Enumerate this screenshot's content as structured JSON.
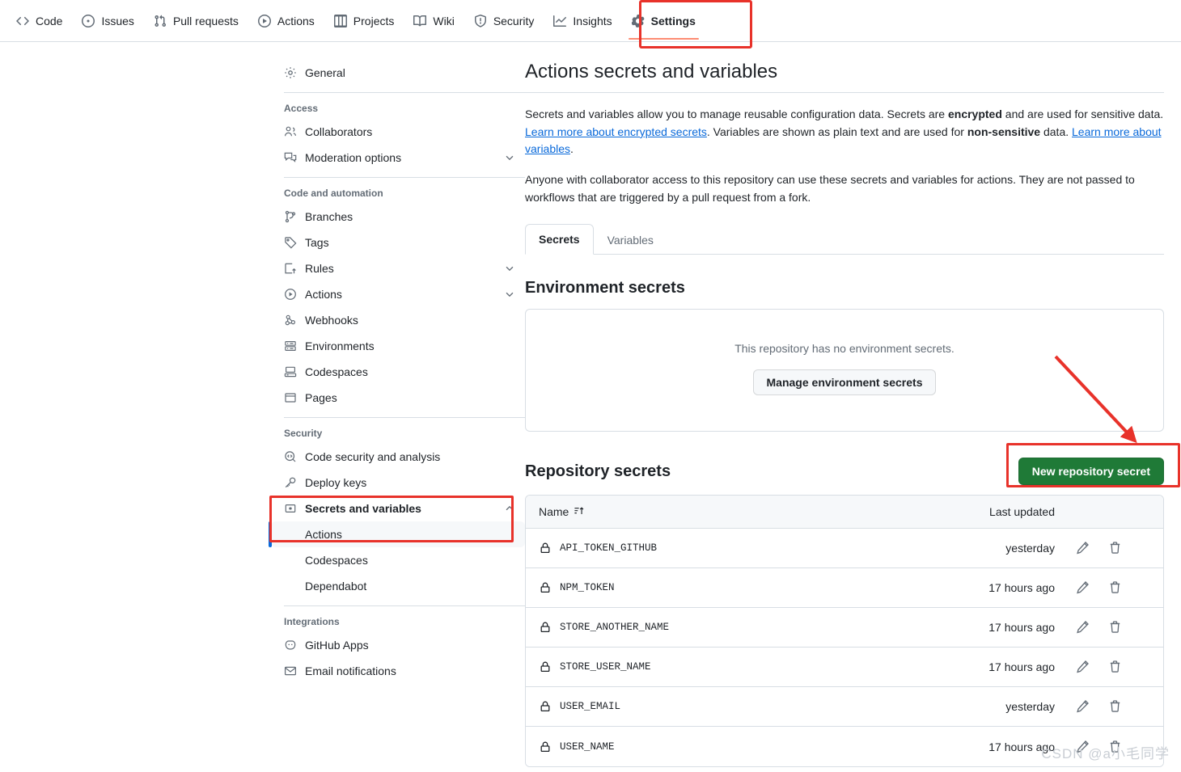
{
  "repo_nav": {
    "items": [
      {
        "label": "Code",
        "icon": "code-icon",
        "selected": false
      },
      {
        "label": "Issues",
        "icon": "issue-opened-icon",
        "selected": false
      },
      {
        "label": "Pull requests",
        "icon": "git-pull-request-icon",
        "selected": false
      },
      {
        "label": "Actions",
        "icon": "play-icon",
        "selected": false
      },
      {
        "label": "Projects",
        "icon": "table-icon",
        "selected": false
      },
      {
        "label": "Wiki",
        "icon": "book-icon",
        "selected": false
      },
      {
        "label": "Security",
        "icon": "shield-icon",
        "selected": false
      },
      {
        "label": "Insights",
        "icon": "graph-icon",
        "selected": false
      },
      {
        "label": "Settings",
        "icon": "gear-icon",
        "selected": true
      }
    ]
  },
  "sidebar": {
    "general": {
      "label": "General",
      "icon": "gear-icon"
    },
    "groups": [
      {
        "heading": "Access",
        "items": [
          {
            "label": "Collaborators",
            "icon": "people-icon",
            "chevron": false
          },
          {
            "label": "Moderation options",
            "icon": "comment-discussion-icon",
            "chevron": true
          }
        ]
      },
      {
        "heading": "Code and automation",
        "items": [
          {
            "label": "Branches",
            "icon": "git-branch-icon",
            "chevron": false
          },
          {
            "label": "Tags",
            "icon": "tag-icon",
            "chevron": false
          },
          {
            "label": "Rules",
            "icon": "rules-icon",
            "chevron": true
          },
          {
            "label": "Actions",
            "icon": "play-icon",
            "chevron": true
          },
          {
            "label": "Webhooks",
            "icon": "webhook-icon",
            "chevron": false
          },
          {
            "label": "Environments",
            "icon": "server-icon",
            "chevron": false
          },
          {
            "label": "Codespaces",
            "icon": "codespaces-icon",
            "chevron": false
          },
          {
            "label": "Pages",
            "icon": "browser-icon",
            "chevron": false
          }
        ]
      },
      {
        "heading": "Security",
        "items": [
          {
            "label": "Code security and analysis",
            "icon": "codescan-icon",
            "chevron": false
          },
          {
            "label": "Deploy keys",
            "icon": "key-icon",
            "chevron": false
          }
        ]
      }
    ],
    "secrets_group": {
      "label": "Secrets and variables",
      "icon": "key-asterisk-icon",
      "chevron": "chevron-up-icon",
      "expanded": true,
      "subitems": [
        {
          "label": "Actions",
          "active": true
        },
        {
          "label": "Codespaces",
          "active": false
        },
        {
          "label": "Dependabot",
          "active": false
        }
      ]
    },
    "integrations": {
      "heading": "Integrations",
      "items": [
        {
          "label": "GitHub Apps",
          "icon": "github-apps-icon"
        },
        {
          "label": "Email notifications",
          "icon": "mail-icon"
        }
      ]
    }
  },
  "main": {
    "title": "Actions secrets and variables",
    "paragraph1": {
      "part1": "Secrets and variables allow you to manage reusable configuration data. Secrets are ",
      "bold1": "encrypted",
      "part2": " and are used for sensitive data. ",
      "link1": "Learn more about encrypted secrets",
      "part3": ". Variables are shown as plain text and are used for ",
      "bold2": "non-sensitive",
      "part4": " data. ",
      "link2": "Learn more about variables",
      "part5": "."
    },
    "paragraph2": "Anyone with collaborator access to this repository can use these secrets and variables for actions. They are not passed to workflows that are triggered by a pull request from a fork.",
    "tabs": [
      {
        "label": "Secrets",
        "active": true
      },
      {
        "label": "Variables",
        "active": false
      }
    ],
    "environment_secrets": {
      "heading": "Environment secrets",
      "empty_message": "This repository has no environment secrets.",
      "manage_button": "Manage environment secrets"
    },
    "repository_secrets": {
      "heading": "Repository secrets",
      "new_button": "New repository secret",
      "columns": {
        "name": "Name",
        "sort_icon": "sort-asc-icon",
        "last_updated": "Last updated"
      },
      "rows": [
        {
          "icon": "lock-icon",
          "name": "API_TOKEN_GITHUB",
          "last_updated": "yesterday",
          "edit_icon": "pencil-icon",
          "delete_icon": "trash-icon"
        },
        {
          "icon": "lock-icon",
          "name": "NPM_TOKEN",
          "last_updated": "17 hours ago",
          "edit_icon": "pencil-icon",
          "delete_icon": "trash-icon"
        },
        {
          "icon": "lock-icon",
          "name": "STORE_ANOTHER_NAME",
          "last_updated": "17 hours ago",
          "edit_icon": "pencil-icon",
          "delete_icon": "trash-icon"
        },
        {
          "icon": "lock-icon",
          "name": "STORE_USER_NAME",
          "last_updated": "17 hours ago",
          "edit_icon": "pencil-icon",
          "delete_icon": "trash-icon"
        },
        {
          "icon": "lock-icon",
          "name": "USER_EMAIL",
          "last_updated": "yesterday",
          "edit_icon": "pencil-icon",
          "delete_icon": "trash-icon"
        },
        {
          "icon": "lock-icon",
          "name": "USER_NAME",
          "last_updated": "17 hours ago",
          "edit_icon": "pencil-icon",
          "delete_icon": "trash-icon"
        }
      ]
    }
  },
  "annotations": {
    "highlight_color": "#e8322a",
    "arrow_color": "#e8322a"
  },
  "watermark": "CSDN @a小毛同学",
  "colors": {
    "green_button": "#1f7a37",
    "link": "#0969da",
    "selected_tab_underline": "#fd8c73",
    "active_subitem_bar": "#0969da"
  }
}
